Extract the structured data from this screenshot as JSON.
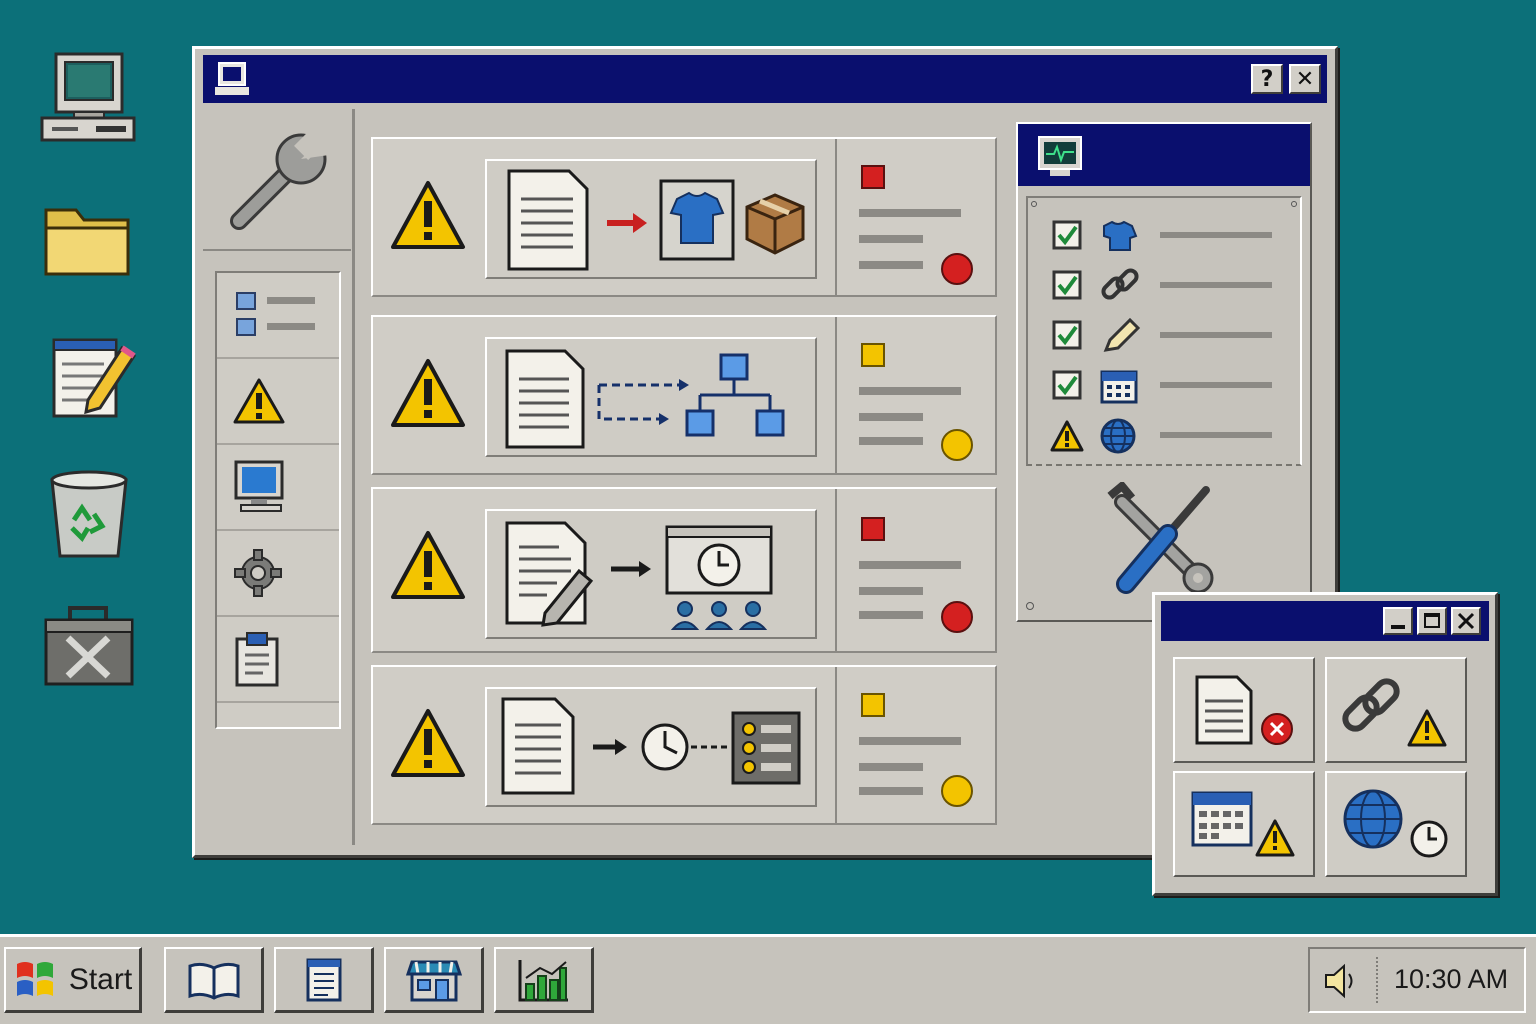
{
  "window": {
    "help_label": "?",
    "close_label": "✕"
  },
  "sidebar": {
    "items": [
      {
        "icon": "list-icon"
      },
      {
        "icon": "warning-icon"
      },
      {
        "icon": "monitor-icon"
      },
      {
        "icon": "gear-icon"
      },
      {
        "icon": "clipboard-icon"
      }
    ]
  },
  "tasks": [
    {
      "flow": "document-to-shirt-and-package",
      "status_color": "#d42020",
      "status": "error"
    },
    {
      "flow": "document-to-hierarchy",
      "status_color": "#f3c400",
      "status": "warning"
    },
    {
      "flow": "edit-document-to-scheduled-meeting",
      "status_color": "#d42020",
      "status": "error"
    },
    {
      "flow": "document-to-timer-to-list",
      "status_color": "#f3c400",
      "status": "warning"
    }
  ],
  "checklist": [
    {
      "state": "checked",
      "icon": "shirt-icon"
    },
    {
      "state": "checked",
      "icon": "link-icon"
    },
    {
      "state": "checked",
      "icon": "pencil-icon"
    },
    {
      "state": "checked",
      "icon": "calendar-icon"
    },
    {
      "state": "warning",
      "icon": "globe-icon"
    }
  ],
  "taskbar": {
    "start_label": "Start",
    "apps": [
      "book-icon",
      "notepad-icon",
      "store-icon",
      "chart-icon"
    ],
    "clock": "10:30 AM"
  },
  "colors": {
    "desktop": "#0c7079",
    "titlebar": "#0a0f6e",
    "error": "#d42020",
    "warning": "#f3c400",
    "accent_blue": "#2a6fc4"
  }
}
